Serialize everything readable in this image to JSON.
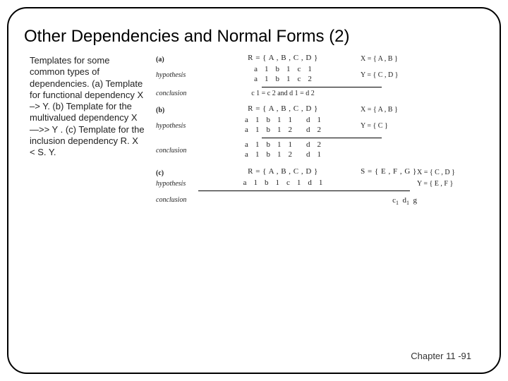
{
  "title": "Other Dependencies and Normal Forms (2)",
  "caption": "Templates for some common types of dependencies. (a) Template for functional dependency X –> Y. (b) Template for the multivalued dependency X —>> Y . (c) Template for the inclusion dependency R. X < S. Y.",
  "labels": {
    "a": "(a)",
    "b": "(b)",
    "c": "(c)",
    "hypothesis": "hypothesis",
    "conclusion": "conclusion"
  },
  "panelA": {
    "R": "R = { A , B , C , D }",
    "X": "X = { A , B }",
    "Y": "Y = { C , D }",
    "row1": [
      "a",
      "1",
      "b",
      "1",
      "c",
      "1"
    ],
    "row2": [
      "a",
      "1",
      "b",
      "1",
      "c",
      "2"
    ],
    "concl": "c 1 = c 2 and d 1 = d 2"
  },
  "panelB": {
    "R": "R = { A , B , C , D }",
    "X": "X = { A , B }",
    "Y": "Y = { C }",
    "row1": [
      "a",
      "1",
      "b",
      "1",
      "1",
      "",
      "d",
      "1"
    ],
    "row2": [
      "a",
      "1",
      "b",
      "1",
      "2",
      "",
      "d",
      "2"
    ],
    "row3": [
      "a",
      "1",
      "b",
      "1",
      "1",
      "",
      "d",
      "2"
    ],
    "row4": [
      "a",
      "1",
      "b",
      "1",
      "2",
      "",
      "d",
      "1"
    ]
  },
  "panelC": {
    "R": "R = { A , B , C , D }",
    "S": "S = { E , F , G }",
    "X": "X = { C , D }",
    "Y": "Y = { E , F }",
    "row1": [
      "a",
      "1",
      "b",
      "1",
      "c",
      "1",
      "d",
      "1"
    ],
    "concl": [
      "c",
      "1",
      "d",
      "1",
      "g"
    ]
  },
  "footer": "Chapter 11 -91"
}
